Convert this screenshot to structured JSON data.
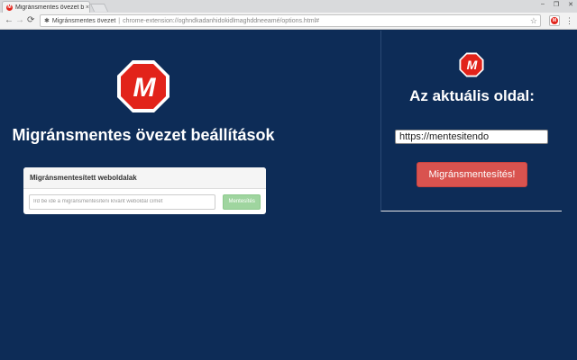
{
  "browser": {
    "tab_title": "Migránsmentes övezet be",
    "tab_close": "×",
    "omnibox": {
      "site_title": "Migránsmentes övezet",
      "url": "chrome-extension://oghndkadanhidokidlmaghddneeamé/options.html#"
    },
    "window_controls": [
      "–",
      "❐",
      "✕"
    ],
    "nav": {
      "back": "←",
      "forward": "→",
      "reload": "⟳"
    },
    "star": "☆",
    "menu": "⋮"
  },
  "logo": {
    "letter": "M"
  },
  "settings": {
    "title": "Migránsmentes övezet beállítások",
    "card_title": "Migránsmentesített weboldalak",
    "input_placeholder": "Írd be ide a migránsmentesíteni kívánt weboldal címét",
    "save_label": "Mentesítés"
  },
  "popup": {
    "title": "Az aktuális oldal:",
    "current_url": "https://mentesitendo",
    "button_label": "Migránsmentesítés!"
  },
  "colors": {
    "background": "#0d2c57",
    "logo_red": "#e2231a",
    "popup_button": "#d9534f",
    "save_button": "#9fd59f"
  },
  "icons": {
    "extension": "puzzle-icon",
    "favicon": "migrant-free-logo-icon"
  }
}
